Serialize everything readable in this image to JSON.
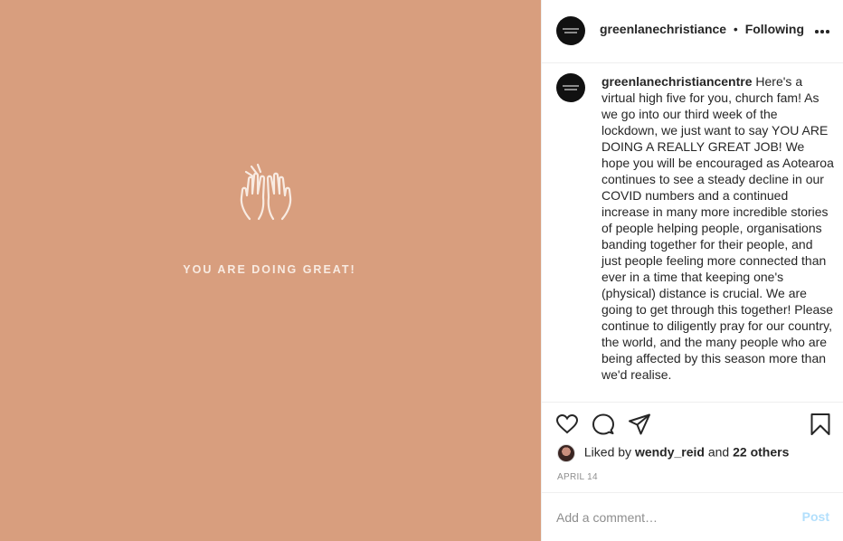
{
  "post_image": {
    "tagline": "YOU ARE DOING GREAT!",
    "background_color": "#d89e7e",
    "icon": "high-five-hands-icon"
  },
  "header": {
    "username": "greenlanechristiancentre",
    "separator": "•",
    "follow_state": "Following",
    "more_icon": "more-options-icon"
  },
  "caption": {
    "username": "greenlanechristiancentre",
    "text": "Here's a virtual high five for you, church fam! As we go into our third week of the lockdown, we just want to say YOU ARE DOING A REALLY GREAT JOB! We hope you will be encouraged as Aotearoa continues to see a steady decline in our COVID numbers and a continued increase in many more incredible stories of people helping people, organisations banding together for their people, and just people feeling more connected than ever in a time that keeping one's (physical) distance is crucial. We are going to get through this together! Please continue to diligently pray for our country, the world, and the many people who are being affected by this season more than we'd realise."
  },
  "actions": {
    "icons": [
      "heart-icon",
      "comment-icon",
      "share-icon",
      "bookmark-icon"
    ]
  },
  "likes": {
    "prefix": "Liked by",
    "user": "wendy_reid",
    "conjunction": "and",
    "others": "22 others"
  },
  "date": "APRIL 14",
  "comment": {
    "placeholder": "Add a comment…",
    "post_label": "Post",
    "post_color": "#b2dffc"
  }
}
